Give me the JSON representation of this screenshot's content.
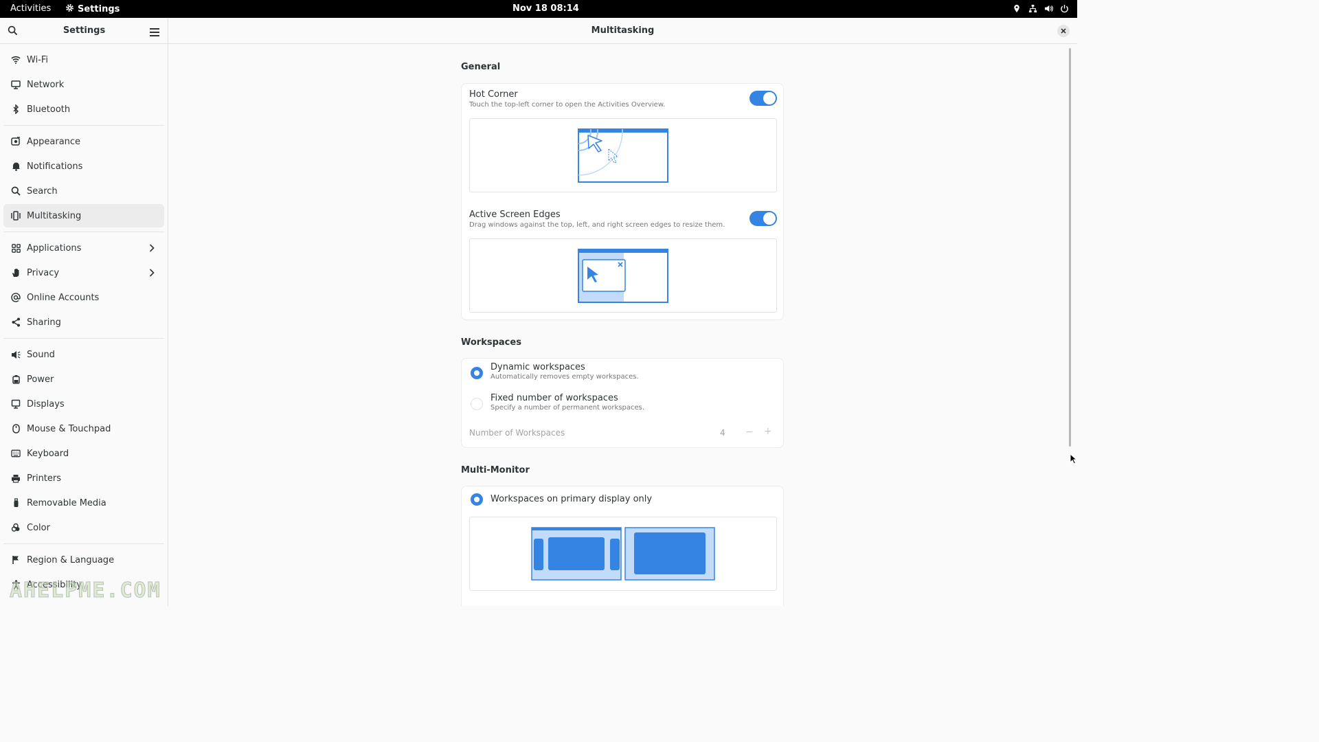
{
  "topbar": {
    "activities": "Activities",
    "app_name": "Settings",
    "clock": "Nov 18  08:14",
    "tray_icons": [
      "location-icon",
      "network-wired-icon",
      "volume-icon",
      "power-icon"
    ]
  },
  "sidebar": {
    "title": "Settings",
    "groups": [
      [
        {
          "label": "Wi-Fi",
          "icon": "wifi-icon"
        },
        {
          "label": "Network",
          "icon": "network-icon"
        },
        {
          "label": "Bluetooth",
          "icon": "bluetooth-icon"
        }
      ],
      [
        {
          "label": "Appearance",
          "icon": "appearance-icon"
        },
        {
          "label": "Notifications",
          "icon": "bell-icon"
        },
        {
          "label": "Search",
          "icon": "search-icon"
        },
        {
          "label": "Multitasking",
          "icon": "multitasking-icon",
          "selected": true
        }
      ],
      [
        {
          "label": "Applications",
          "icon": "apps-grid-icon",
          "chevron": true
        },
        {
          "label": "Privacy",
          "icon": "hand-icon",
          "chevron": true
        },
        {
          "label": "Online Accounts",
          "icon": "at-icon"
        },
        {
          "label": "Sharing",
          "icon": "share-icon"
        }
      ],
      [
        {
          "label": "Sound",
          "icon": "speaker-icon"
        },
        {
          "label": "Power",
          "icon": "power-icon"
        },
        {
          "label": "Displays",
          "icon": "display-icon"
        },
        {
          "label": "Mouse & Touchpad",
          "icon": "mouse-icon"
        },
        {
          "label": "Keyboard",
          "icon": "keyboard-icon"
        },
        {
          "label": "Printers",
          "icon": "printer-icon"
        },
        {
          "label": "Removable Media",
          "icon": "usb-icon"
        },
        {
          "label": "Color",
          "icon": "color-icon"
        }
      ],
      [
        {
          "label": "Region & Language",
          "icon": "flag-icon"
        },
        {
          "label": "Accessibility",
          "icon": "accessibility-icon"
        }
      ]
    ]
  },
  "watermark": "AHELPME.COM",
  "main": {
    "title": "Multitasking",
    "general": {
      "title": "General",
      "hot_corner": {
        "title": "Hot Corner",
        "subtitle": "Touch the top-left corner to open the Activities Overview.",
        "enabled": true
      },
      "active_edges": {
        "title": "Active Screen Edges",
        "subtitle": "Drag windows against the top, left, and right screen edges to resize them.",
        "enabled": true
      }
    },
    "workspaces": {
      "title": "Workspaces",
      "dynamic": {
        "title": "Dynamic workspaces",
        "subtitle": "Automatically removes empty workspaces.",
        "selected": true
      },
      "fixed": {
        "title": "Fixed number of workspaces",
        "subtitle": "Specify a number of permanent workspaces.",
        "selected": false
      },
      "count_label": "Number of Workspaces",
      "count_value": "4",
      "minus": "−",
      "plus": "+"
    },
    "multi_monitor": {
      "title": "Multi-Monitor",
      "primary_only": {
        "title": "Workspaces on primary display only",
        "selected": true
      }
    }
  },
  "colors": {
    "accent": "#3584e4",
    "illustration_light": "#c2dbf8"
  }
}
